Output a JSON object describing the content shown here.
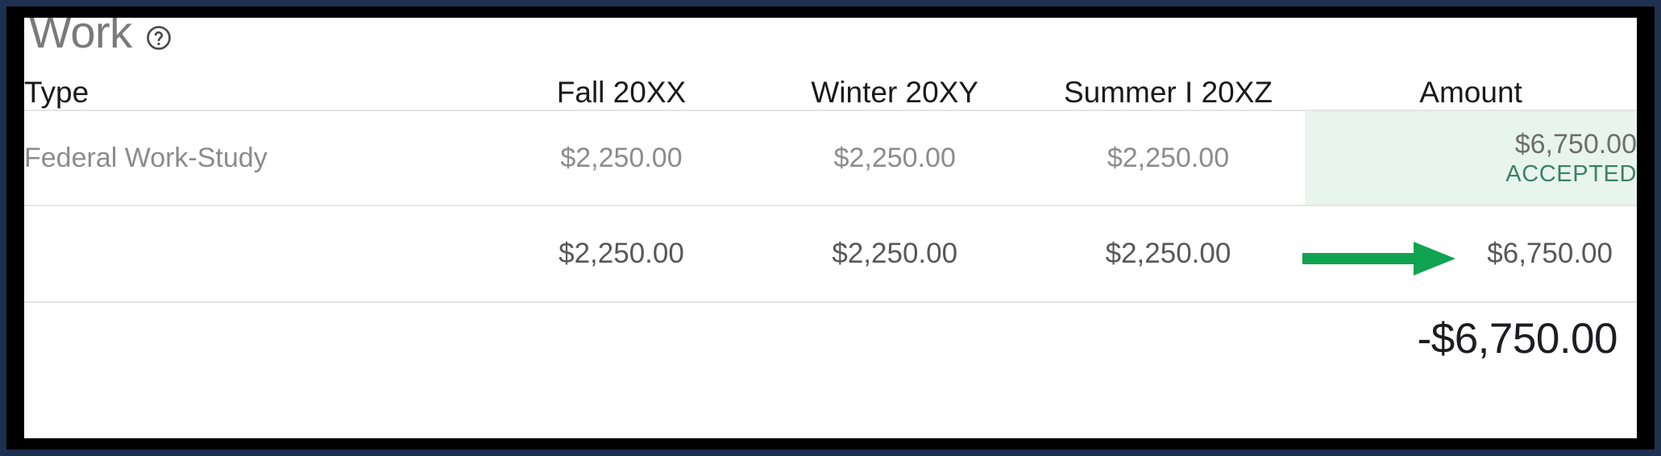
{
  "window": {
    "outer_border_color": "#1e3050",
    "inner_border_color": "#000000",
    "panel_background": "#ffffff"
  },
  "section": {
    "title": "Work",
    "help_icon": "help-circle-icon",
    "title_color": "#7a7a7a"
  },
  "table": {
    "columns": [
      {
        "key": "type",
        "label": "Type",
        "align": "left"
      },
      {
        "key": "fall",
        "label": "Fall 20XX",
        "align": "center"
      },
      {
        "key": "winter",
        "label": "Winter 20XY",
        "align": "center"
      },
      {
        "key": "summer",
        "label": "Summer I 20XZ",
        "align": "center"
      },
      {
        "key": "amount",
        "label": "Amount",
        "align": "center"
      }
    ],
    "rows": [
      {
        "type": "Federal Work-Study",
        "fall": "$2,250.00",
        "winter": "$2,250.00",
        "summer": "$2,250.00",
        "amount": "$6,750.00",
        "status": "ACCEPTED",
        "status_color": "#3c8068",
        "highlight_color": "#e8f5ee"
      }
    ],
    "totals": {
      "type": "",
      "fall": "$2,250.00",
      "winter": "$2,250.00",
      "summer": "$2,250.00",
      "amount": "$6,750.00"
    },
    "net": {
      "amount": "-$6,750.00"
    }
  },
  "annotation": {
    "arrow": "right-arrow-annotation",
    "color": "#0fa352",
    "points_to": "Amount"
  }
}
